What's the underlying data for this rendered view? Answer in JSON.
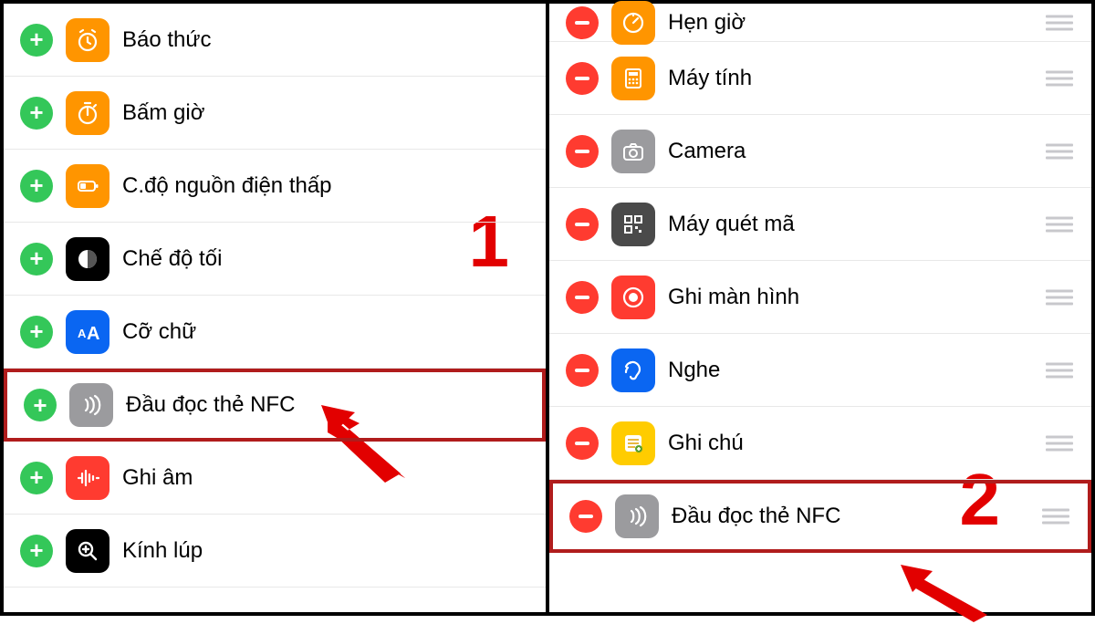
{
  "left": {
    "callout": "1",
    "items": [
      {
        "label": "Báo thức",
        "action": "add",
        "icon": "alarm",
        "bg": "#ff9500"
      },
      {
        "label": "Bấm giờ",
        "action": "add",
        "icon": "stopwatch",
        "bg": "#ff9500"
      },
      {
        "label": "C.độ nguồn điện thấp",
        "action": "add",
        "icon": "battery",
        "bg": "#ff9500"
      },
      {
        "label": "Chế độ tối",
        "action": "add",
        "icon": "dark",
        "bg": "#000000"
      },
      {
        "label": "Cỡ chữ",
        "action": "add",
        "icon": "textsize",
        "bg": "#0a66f2"
      },
      {
        "label": "Đầu đọc thẻ NFC",
        "action": "add",
        "icon": "nfc",
        "bg": "#9b9b9e",
        "highlight": true
      },
      {
        "label": "Ghi âm",
        "action": "add",
        "icon": "soundwave",
        "bg": "#ff3b30"
      },
      {
        "label": "Kính lúp",
        "action": "add",
        "icon": "magnifier",
        "bg": "#000000"
      }
    ]
  },
  "right": {
    "callout": "2",
    "items": [
      {
        "label": "Hẹn giờ",
        "action": "remove",
        "icon": "timer",
        "bg": "#ff9500",
        "partial": true
      },
      {
        "label": "Máy tính",
        "action": "remove",
        "icon": "calculator",
        "bg": "#ff9500"
      },
      {
        "label": "Camera",
        "action": "remove",
        "icon": "camera",
        "bg": "#9b9b9e"
      },
      {
        "label": "Máy quét mã",
        "action": "remove",
        "icon": "qr",
        "bg": "#4a4a4a"
      },
      {
        "label": "Ghi màn hình",
        "action": "remove",
        "icon": "record",
        "bg": "#ff3b30"
      },
      {
        "label": "Nghe",
        "action": "remove",
        "icon": "hearing",
        "bg": "#0a66f2"
      },
      {
        "label": "Ghi chú",
        "action": "remove",
        "icon": "notes",
        "bg": "#ffcc00"
      },
      {
        "label": "Đầu đọc thẻ NFC",
        "action": "remove",
        "icon": "nfc",
        "bg": "#9b9b9e",
        "highlight": true
      }
    ]
  }
}
